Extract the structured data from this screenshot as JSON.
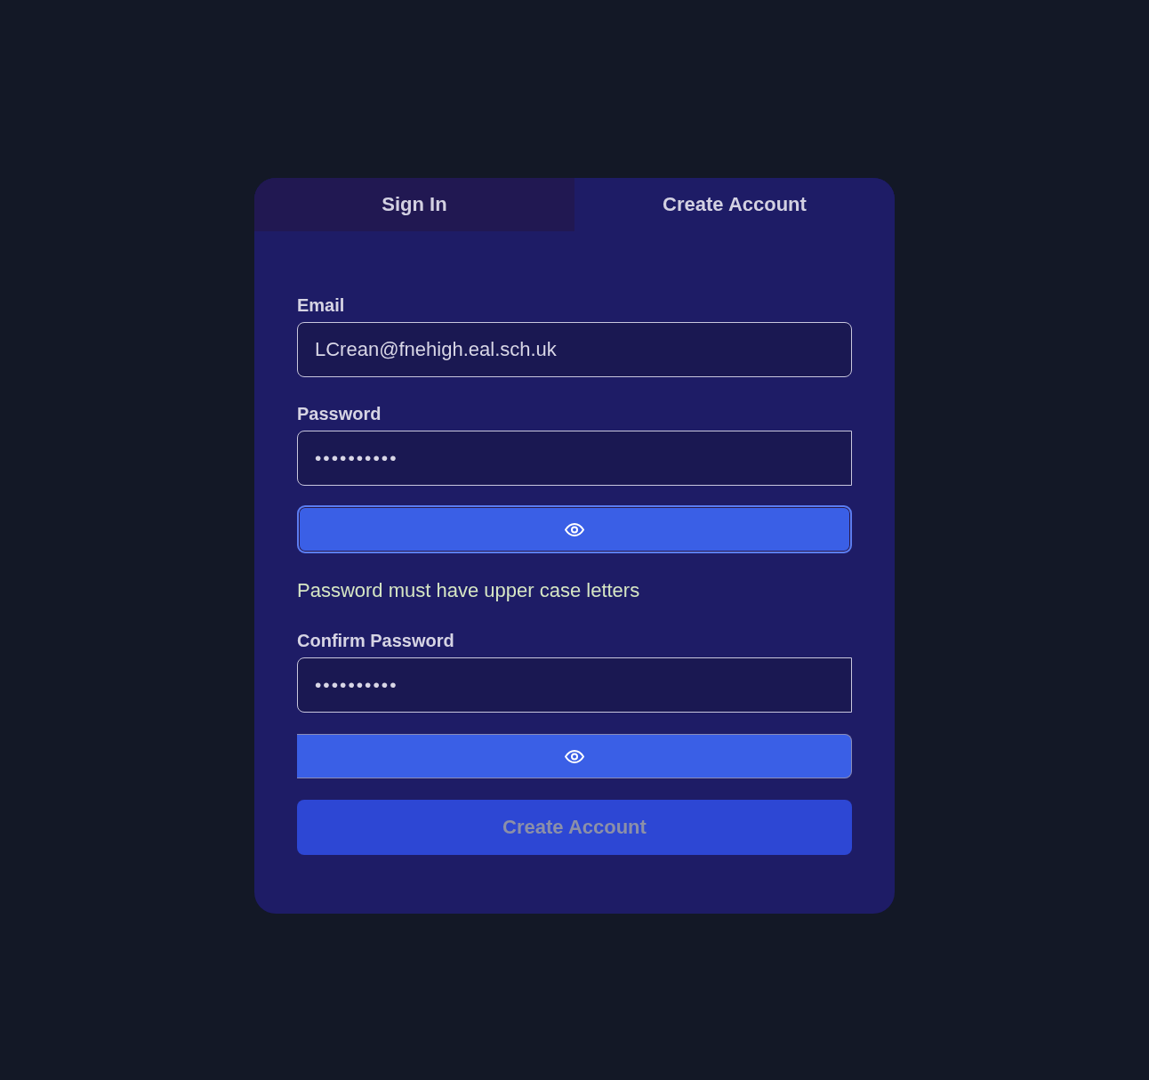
{
  "tabs": [
    {
      "label": "Sign In",
      "selected": false
    },
    {
      "label": "Create Account",
      "selected": true
    }
  ],
  "fields": [
    {
      "kind": "email",
      "label": "Email",
      "value": "LCrean@fnehigh.eal.sch.uk"
    },
    {
      "kind": "password",
      "label": "Password",
      "value": "••••••••••",
      "reveal_button": {
        "focused": true
      },
      "error": "Password must have upper case letters"
    },
    {
      "kind": "password",
      "label": "Confirm Password",
      "value": "••••••••••",
      "reveal_button": {
        "focused": false
      }
    }
  ],
  "submit": {
    "label": "Create Account",
    "disabled": true
  }
}
